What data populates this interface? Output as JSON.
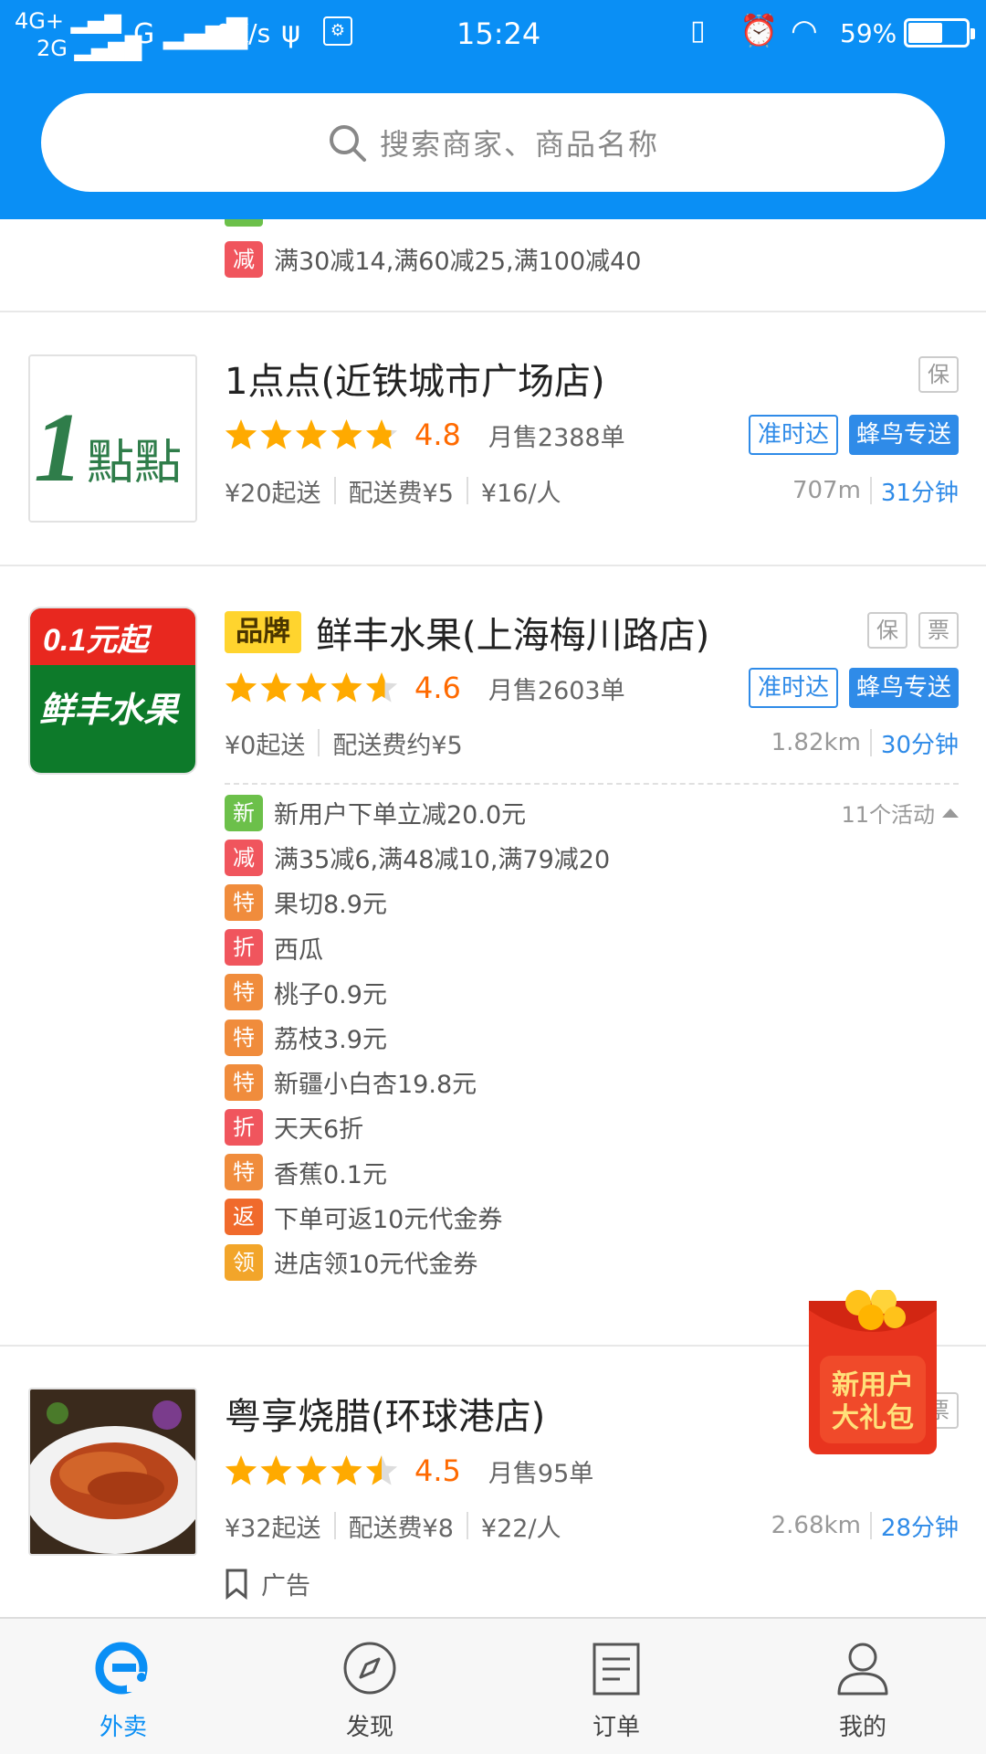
{
  "status_bar": {
    "network_top": "4G+",
    "network_bottom": "2G",
    "network_g": "G",
    "speed": "0K/s",
    "time": "15:24",
    "battery_pct": "59%",
    "battery_level": 0.59
  },
  "search": {
    "placeholder": "搜索商家、商品名称"
  },
  "prev_shop_activity": {
    "tag": "减",
    "tag_color": "#f0555d",
    "text": "满30减14,满60减25,满100减40"
  },
  "shops": [
    {
      "name": "1点点(近铁城市广场店)",
      "logo_text_big": "1",
      "logo_text_small": "點點",
      "rating": 4.8,
      "rating_label": "4.8",
      "monthly_sales": "月售2388单",
      "services": [
        "准时达",
        "蜂鸟专送"
      ],
      "corner_badges": [
        "保"
      ],
      "min_order": "¥20起送",
      "delivery_fee": "配送费¥5",
      "per_person": "¥16/人",
      "distance": "707m",
      "eta": "31分钟"
    },
    {
      "brand_badge": "品牌",
      "name": "鲜丰水果(上海梅川路店)",
      "logo_text_top": "0.1元起",
      "logo_text_bottom": "鲜丰水果",
      "rating": 4.6,
      "rating_label": "4.6",
      "monthly_sales": "月售2603单",
      "services": [
        "准时达",
        "蜂鸟专送"
      ],
      "corner_badges": [
        "保",
        "票"
      ],
      "min_order": "¥0起送",
      "delivery_fee": "配送费约¥5",
      "distance": "1.82km",
      "eta": "30分钟",
      "activity_count": "11个活动",
      "activities": [
        {
          "tag": "新",
          "color": "#6cc04a",
          "text": "新用户下单立减20.0元"
        },
        {
          "tag": "减",
          "color": "#f0555d",
          "text": "满35减6,满48减10,满79减20"
        },
        {
          "tag": "特",
          "color": "#f08c3c",
          "text": "果切8.9元"
        },
        {
          "tag": "折",
          "color": "#f0555d",
          "text": "西瓜"
        },
        {
          "tag": "特",
          "color": "#f08c3c",
          "text": "桃子0.9元"
        },
        {
          "tag": "特",
          "color": "#f08c3c",
          "text": "荔枝3.9元"
        },
        {
          "tag": "特",
          "color": "#f08c3c",
          "text": "新疆小白杏19.8元"
        },
        {
          "tag": "折",
          "color": "#f0555d",
          "text": "天天6折"
        },
        {
          "tag": "特",
          "color": "#f08c3c",
          "text": "香蕉0.1元"
        },
        {
          "tag": "返",
          "color": "#f06a2c",
          "text": "下单可返10元代金券"
        },
        {
          "tag": "领",
          "color": "#f2a52a",
          "text": "进店领10元代金券"
        }
      ]
    },
    {
      "name": "粤享烧腊(环球港店)",
      "rating": 4.5,
      "rating_label": "4.5",
      "monthly_sales": "月售95单",
      "corner_badges": [
        "票"
      ],
      "min_order": "¥32起送",
      "delivery_fee": "配送费¥8",
      "per_person": "¥22/人",
      "distance": "2.68km",
      "eta": "28分钟",
      "ad_label": "广告"
    }
  ],
  "red_packet": {
    "line1": "新用户",
    "line2": "大礼包"
  },
  "bottom_nav": [
    {
      "label": "外卖",
      "icon": "eleme-icon",
      "active": true
    },
    {
      "label": "发现",
      "icon": "compass-icon",
      "active": false
    },
    {
      "label": "订单",
      "icon": "order-icon",
      "active": false
    },
    {
      "label": "我的",
      "icon": "user-icon",
      "active": false
    }
  ],
  "colors": {
    "header": "#0a8ff5",
    "accent": "#2f8be8",
    "rating": "#ff6a00",
    "star": "#ffaa00"
  }
}
